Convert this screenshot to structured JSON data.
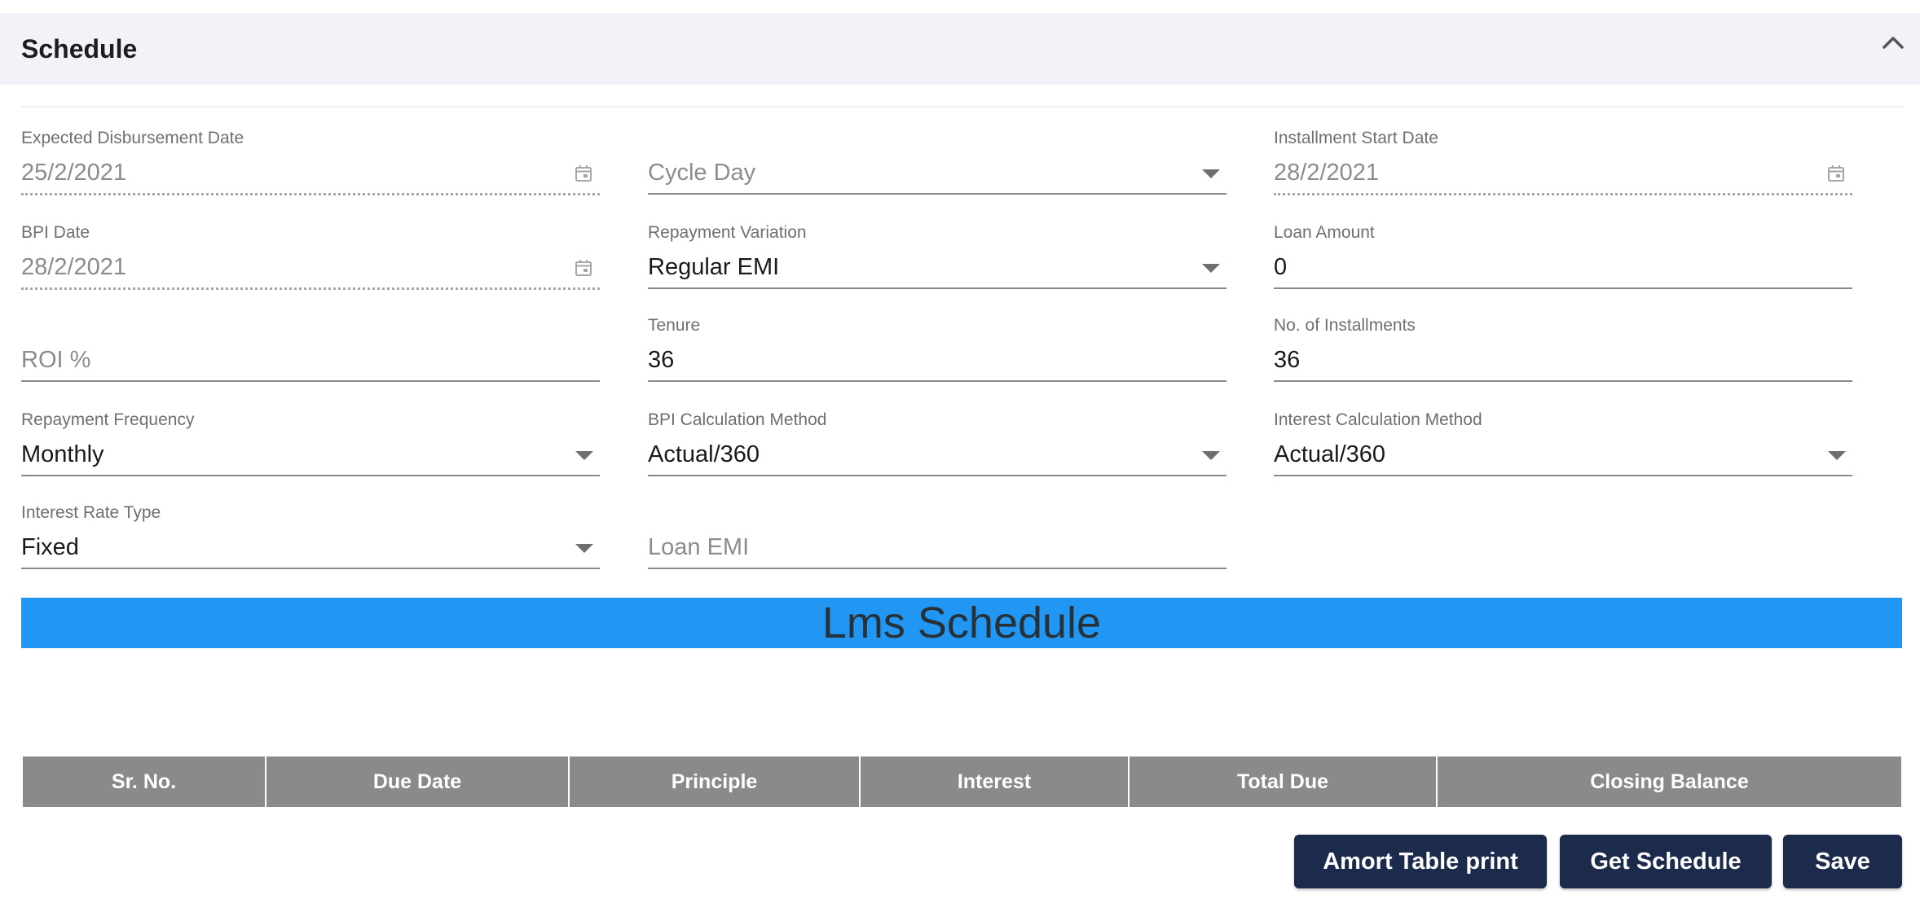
{
  "header": {
    "title": "Schedule",
    "collapse_icon": "chevron-up-icon"
  },
  "form": {
    "expected_disbursement_date": {
      "label": "Expected Disbursement Date",
      "value": "25/2/2021"
    },
    "cycle_day": {
      "placeholder": "Cycle Day"
    },
    "installment_start_date": {
      "label": "Installment Start Date",
      "value": "28/2/2021"
    },
    "bpi_date": {
      "label": "BPI Date",
      "value": "28/2/2021"
    },
    "repayment_variation": {
      "label": "Repayment Variation",
      "value": "Regular EMI"
    },
    "loan_amount": {
      "label": "Loan Amount",
      "value": "0"
    },
    "roi": {
      "placeholder": "ROI %"
    },
    "tenure": {
      "label": "Tenure",
      "value": "36"
    },
    "no_of_installments": {
      "label": "No. of Installments",
      "value": "36"
    },
    "repayment_frequency": {
      "label": "Repayment Frequency",
      "value": "Monthly"
    },
    "bpi_calculation_method": {
      "label": "BPI Calculation Method",
      "value": "Actual/360"
    },
    "interest_calculation_method": {
      "label": "Interest Calculation Method",
      "value": "Actual/360"
    },
    "interest_rate_type": {
      "label": "Interest Rate Type",
      "value": "Fixed"
    },
    "loan_emi": {
      "placeholder": "Loan EMI"
    }
  },
  "banner": {
    "title": "Lms Schedule",
    "color": "#2196f3"
  },
  "table": {
    "columns": [
      "Sr. No.",
      "Due Date",
      "Principle",
      "Interest",
      "Total Due",
      "Closing Balance"
    ],
    "rows": []
  },
  "actions": {
    "amort_table_print": "Amort Table print",
    "get_schedule": "Get Schedule",
    "save": "Save",
    "button_color": "#1c2b4c"
  }
}
